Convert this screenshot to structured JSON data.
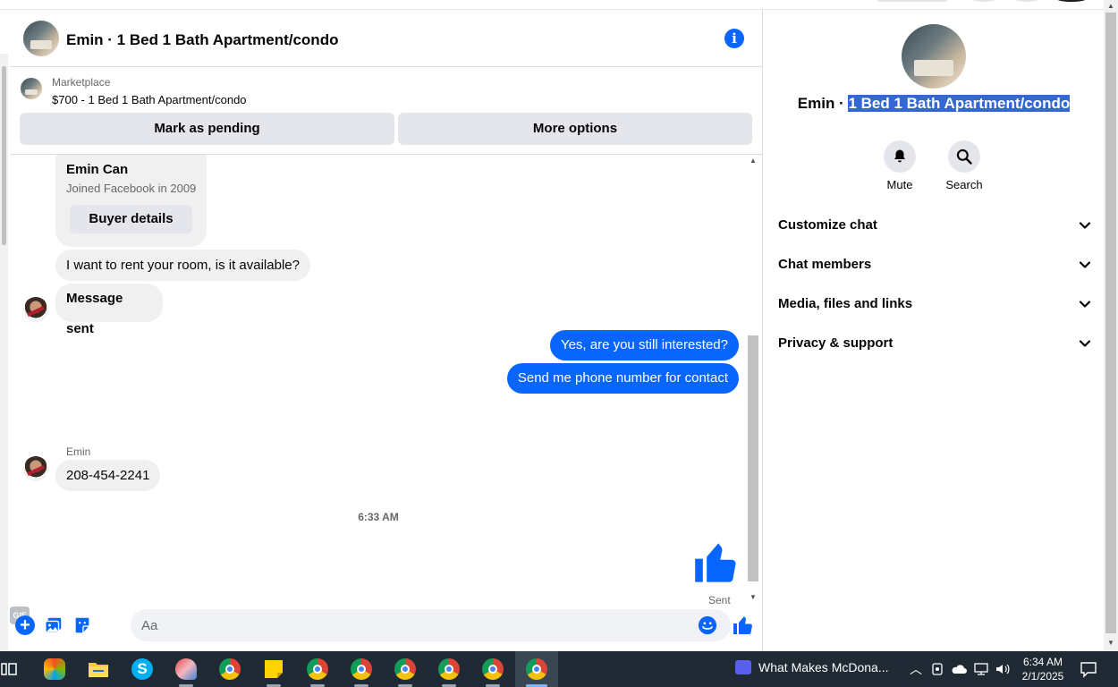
{
  "chat": {
    "header_title": "Emin · 1 Bed 1 Bath Apartment/condo",
    "marketplace_label": "Marketplace",
    "listing": "$700 - 1 Bed 1 Bath Apartment/condo",
    "mark_pending": "Mark as pending",
    "more_options": "More options"
  },
  "messages": {
    "card_name": "Emin Can",
    "card_sub": "Joined Facebook in 2009",
    "card_button": "Buyer details",
    "rent_msg": "I want to rent your room, is it available?",
    "sent_notice": "Message sent",
    "out_1": "Yes, are you still interested?",
    "out_2": "Send me phone number for contact",
    "sender_name": "Emin",
    "phone_msg": "208-454-2241",
    "timestamp": "6:33 AM",
    "sent_status": "Sent"
  },
  "composer": {
    "placeholder": "Aa",
    "gif": "GIF"
  },
  "side": {
    "title_prefix": "Emin · ",
    "title_selected": "1 Bed 1 Bath Apartment/condo",
    "mute": "Mute",
    "search": "Search",
    "accordion": [
      "Customize chat",
      "Chat members",
      "Media, files and links",
      "Privacy & support"
    ]
  },
  "taskbar": {
    "media_title": "What Makes McDona...",
    "time": "6:34 AM",
    "date": "2/1/2025"
  },
  "colors": {
    "accent": "#0866ff",
    "bubble_in": "#f0f0f0",
    "selection": "#3367d6",
    "taskbar": "#1f2a35"
  }
}
